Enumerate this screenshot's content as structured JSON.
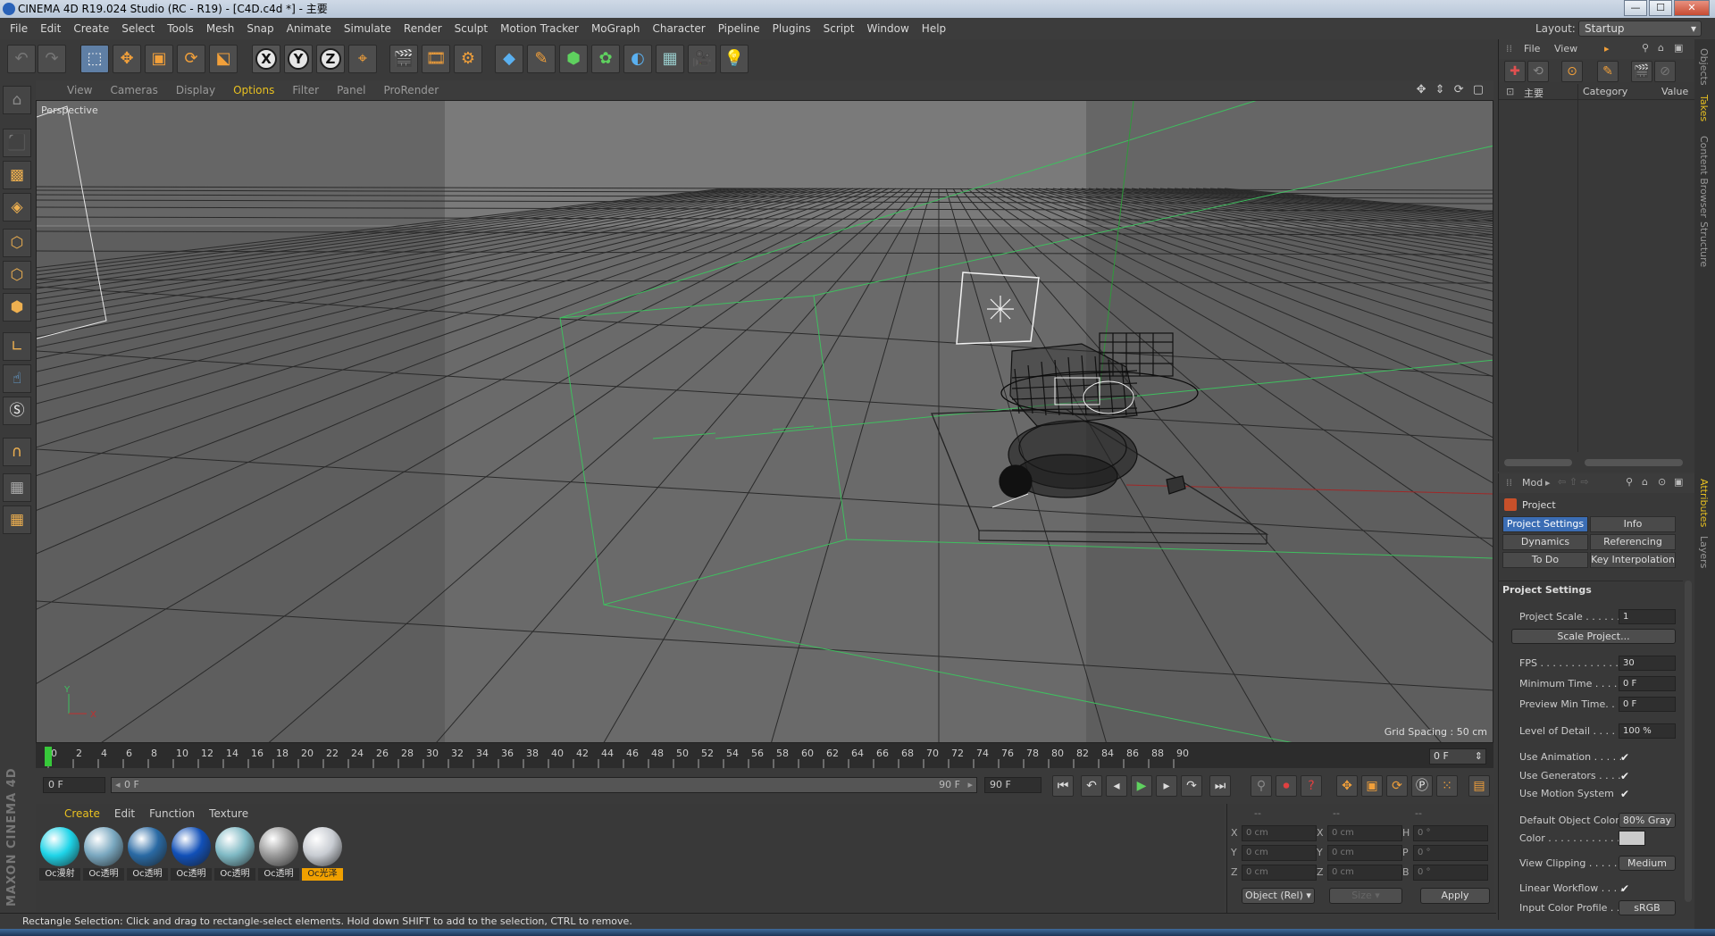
{
  "window": {
    "title": "CINEMA 4D R19.024 Studio (RC - R19) - [C4D.c4d *] - 主要",
    "min": "—",
    "max": "☐",
    "close": "✕"
  },
  "menubar": [
    "File",
    "Edit",
    "Create",
    "Select",
    "Tools",
    "Mesh",
    "Snap",
    "Animate",
    "Simulate",
    "Render",
    "Sculpt",
    "Motion Tracker",
    "MoGraph",
    "Character",
    "Pipeline",
    "Plugins",
    "Script",
    "Window",
    "Help"
  ],
  "layout": {
    "label": "Layout:",
    "value": "Startup"
  },
  "toolbar": {
    "undo_icon": "undo-icon",
    "redo_icon": "redo-icon",
    "axes": [
      "X",
      "Y",
      "Z"
    ]
  },
  "viewport": {
    "menu": [
      "View",
      "Cameras",
      "Display",
      "Options",
      "Filter",
      "Panel",
      "ProRender"
    ],
    "active_menu": "Options",
    "camera": "Perspective",
    "grid_spacing": "Grid Spacing : 50 cm",
    "axis_y": "Y",
    "axis_x": "X"
  },
  "timeline": {
    "ticks": [
      "0",
      "2",
      "4",
      "6",
      "8",
      "10",
      "12",
      "14",
      "16",
      "18",
      "20",
      "22",
      "24",
      "26",
      "28",
      "30",
      "32",
      "34",
      "36",
      "38",
      "40",
      "42",
      "44",
      "46",
      "48",
      "50",
      "52",
      "54",
      "56",
      "58",
      "60",
      "62",
      "64",
      "66",
      "68",
      "70",
      "72",
      "74",
      "76",
      "78",
      "80",
      "82",
      "84",
      "86",
      "88",
      "90"
    ],
    "current_frame": "0 F"
  },
  "transport": {
    "start": "0 F",
    "range_start": "0 F",
    "range_end": "90 F",
    "end": "90 F"
  },
  "materials": {
    "menu": [
      "Create",
      "Edit",
      "Function",
      "Texture"
    ],
    "items": [
      {
        "label": "Oc漫射",
        "color": "#1ed4e8",
        "selected": false
      },
      {
        "label": "Oc透明",
        "color": "#7aa8c0",
        "selected": false
      },
      {
        "label": "Oc透明",
        "color": "#2a6aa4",
        "selected": false
      },
      {
        "label": "Oc透明",
        "color": "#1150b8",
        "selected": false
      },
      {
        "label": "Oc透明",
        "color": "#7fb9c4",
        "selected": false
      },
      {
        "label": "Oc透明",
        "color": "#9a9a9a",
        "selected": false
      },
      {
        "label": "Oc光泽",
        "color": "#c8ccd2",
        "selected": true
      }
    ]
  },
  "coords": {
    "header": [
      "--",
      "--",
      "--"
    ],
    "rows": [
      {
        "a": "X",
        "av": "0 cm",
        "b": "X",
        "bv": "0 cm",
        "c": "H",
        "cv": "0 °"
      },
      {
        "a": "Y",
        "av": "0 cm",
        "b": "Y",
        "bv": "0 cm",
        "c": "P",
        "cv": "0 °"
      },
      {
        "a": "Z",
        "av": "0 cm",
        "b": "Z",
        "bv": "0 cm",
        "c": "B",
        "cv": "0 °"
      }
    ],
    "mode": "Object (Rel)",
    "size": "Size",
    "apply": "Apply"
  },
  "brand": "MAXON CINEMA 4D",
  "status": "Rectangle Selection: Click and drag to rectangle-select elements. Hold down SHIFT to add to the selection, CTRL to remove.",
  "objects": {
    "menu": [
      "File",
      "View"
    ],
    "take": "主要",
    "col_category": "Category",
    "col_value": "Value"
  },
  "attributes": {
    "mode": "Mod",
    "object": "Project",
    "tabs": [
      "Project Settings",
      "Info",
      "Dynamics",
      "Referencing",
      "To Do",
      "Key Interpolation"
    ],
    "section": "Project Settings",
    "rows": [
      {
        "label": "Project Scale . . . . . . .",
        "value": "1",
        "kind": "field"
      },
      {
        "label": "",
        "value": "Scale Project...",
        "kind": "wide"
      },
      {
        "label": "FPS . . . . . . . . . . . . . .",
        "value": "30",
        "kind": "field"
      },
      {
        "label": "Minimum Time . . . .",
        "value": "0 F",
        "kind": "field"
      },
      {
        "label": "Preview Min Time. . .",
        "value": "0 F",
        "kind": "field"
      },
      {
        "label": "Level of Detail . . . . .",
        "value": "100 %",
        "kind": "field"
      },
      {
        "label": "Use Animation . . . . .",
        "value": "✔",
        "kind": "check"
      },
      {
        "label": "Use Generators . . . .",
        "value": "✔",
        "kind": "check"
      },
      {
        "label": "Use Motion System",
        "value": "✔",
        "kind": "check"
      },
      {
        "label": "Default Object Color",
        "value": "80% Gray",
        "kind": "button"
      },
      {
        "label": "Color . . . . . . . . . . . .",
        "value": "",
        "kind": "swatch"
      },
      {
        "label": "View Clipping . . . . .",
        "value": "Medium",
        "kind": "button"
      },
      {
        "label": "Linear Workflow . . . .",
        "value": "✔",
        "kind": "check"
      },
      {
        "label": "Input Color Profile . .",
        "value": "sRGB",
        "kind": "button"
      }
    ]
  },
  "side_tabs": [
    "Objects",
    "Takes",
    "Content Browser",
    "Structure",
    "Attributes",
    "Layers"
  ],
  "active_side_tab": "Takes"
}
